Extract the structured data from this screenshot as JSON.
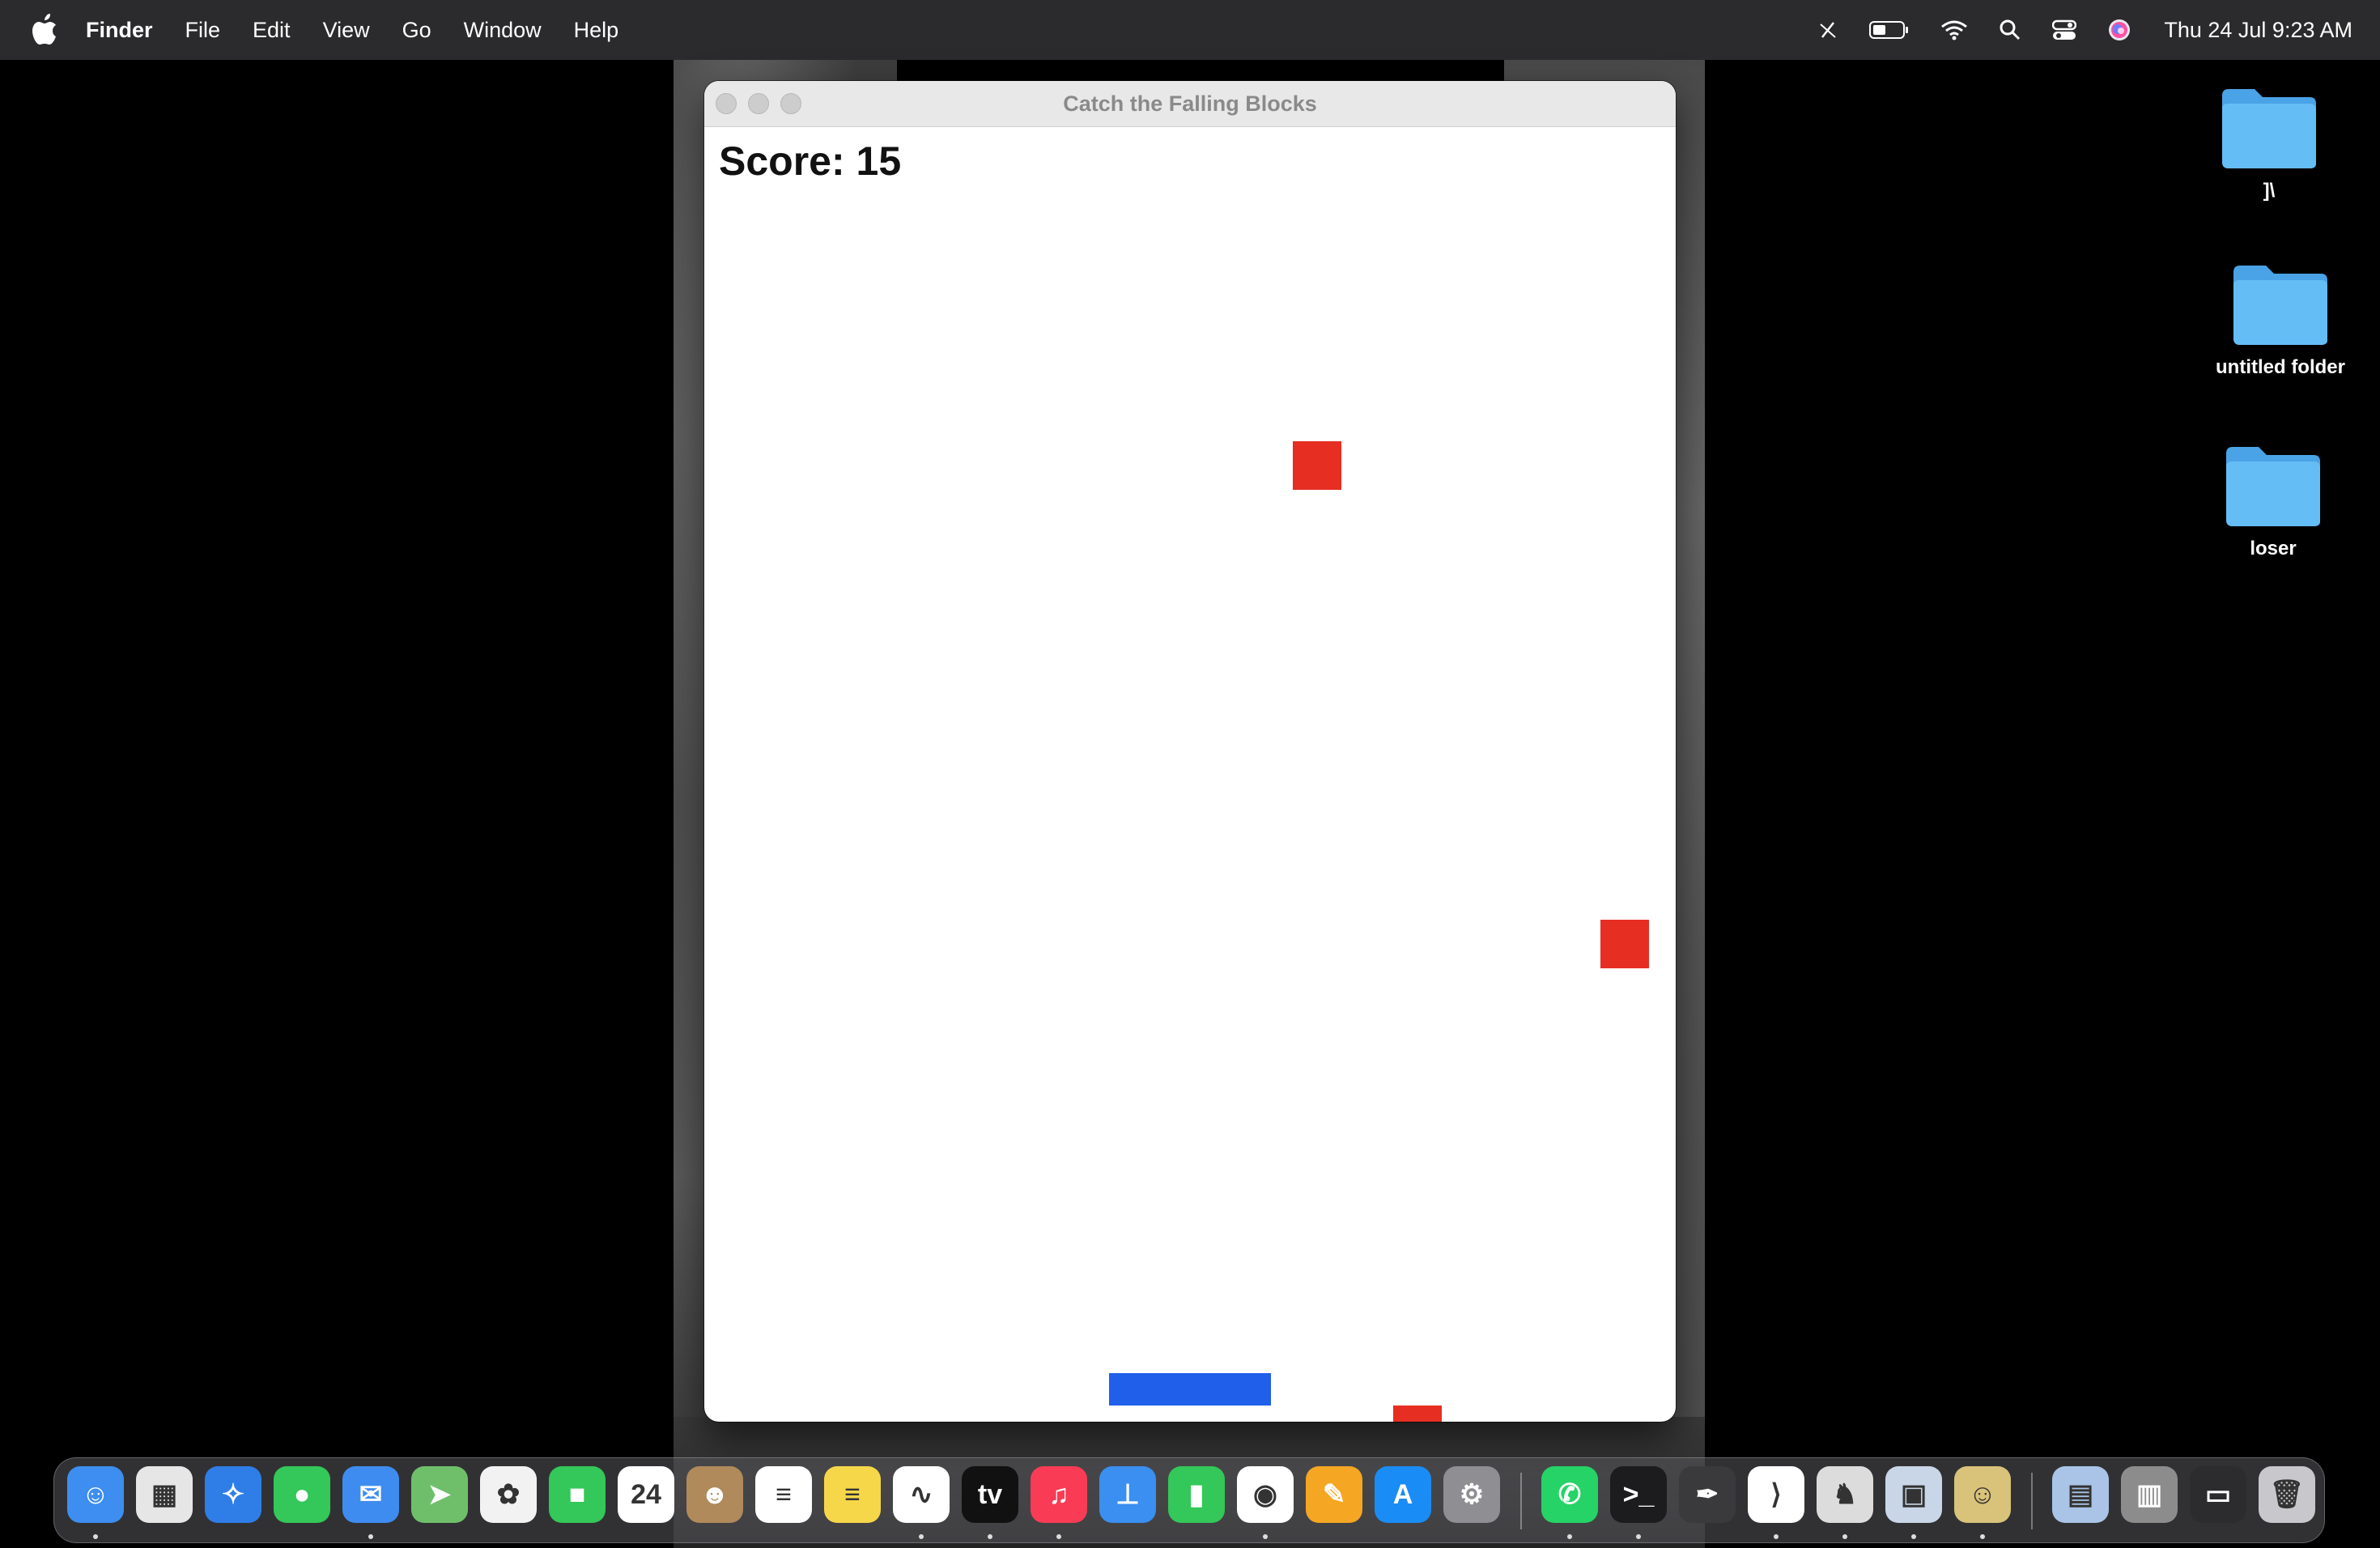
{
  "menubar": {
    "app_name": "Finder",
    "menus": [
      "File",
      "Edit",
      "View",
      "Go",
      "Window",
      "Help"
    ],
    "status_icons": [
      "pen-slash-icon",
      "battery-icon",
      "wifi-icon",
      "search-icon",
      "control-center-icon",
      "siri-icon"
    ],
    "clock": "Thu 24 Jul  9:23 AM"
  },
  "window": {
    "title": "Catch the Falling Blocks",
    "score_text": "Score: 15"
  },
  "game": {
    "score": 15,
    "block_color": "#e62e22",
    "paddle_color": "#1f5fea"
  },
  "desktop": {
    "folders": [
      {
        "label": "]\\"
      },
      {
        "label": "untitled folder"
      },
      {
        "label": "loser"
      }
    ],
    "folder_color": "#5db6f0"
  },
  "dock": {
    "apps": [
      {
        "name": "finder-icon",
        "color": "#3d8ef0",
        "glyph": "☺"
      },
      {
        "name": "launchpad-icon",
        "color": "#e6e6e6",
        "glyph": "▦"
      },
      {
        "name": "safari-icon",
        "color": "#2f7ee8",
        "glyph": "✧"
      },
      {
        "name": "messages-icon",
        "color": "#34c759",
        "glyph": "●"
      },
      {
        "name": "mail-icon",
        "color": "#3f8cf0",
        "glyph": "✉"
      },
      {
        "name": "maps-icon",
        "color": "#6fbf6a",
        "glyph": "➤"
      },
      {
        "name": "photos-icon",
        "color": "#f2f2f2",
        "glyph": "✿"
      },
      {
        "name": "facetime-icon",
        "color": "#34c759",
        "glyph": "■"
      },
      {
        "name": "calendar-icon",
        "color": "#ffffff",
        "glyph": "24"
      },
      {
        "name": "contacts-icon",
        "color": "#b08a5a",
        "glyph": "☻"
      },
      {
        "name": "reminders-icon",
        "color": "#ffffff",
        "glyph": "≡"
      },
      {
        "name": "notes-icon",
        "color": "#f7d74a",
        "glyph": "≡"
      },
      {
        "name": "freeform-icon",
        "color": "#ffffff",
        "glyph": "∿"
      },
      {
        "name": "apple-tv-icon",
        "color": "#111111",
        "glyph": "tv"
      },
      {
        "name": "music-icon",
        "color": "#fa3b55",
        "glyph": "♫"
      },
      {
        "name": "keynote-icon",
        "color": "#3a8ff0",
        "glyph": "⊥"
      },
      {
        "name": "numbers-icon",
        "color": "#34c759",
        "glyph": "▮"
      },
      {
        "name": "chrome-icon",
        "color": "#ffffff",
        "glyph": "◉"
      },
      {
        "name": "pages-icon",
        "color": "#f5a623",
        "glyph": "✎"
      },
      {
        "name": "app-store-icon",
        "color": "#1a8cf5",
        "glyph": "A"
      },
      {
        "name": "system-settings-icon",
        "color": "#8e8e93",
        "glyph": "⚙"
      },
      {
        "name": "whatsapp-icon",
        "color": "#25d366",
        "glyph": "✆"
      },
      {
        "name": "terminal-icon",
        "color": "#1c1c1e",
        "glyph": ">_"
      },
      {
        "name": "pen-tool-icon",
        "color": "#3a3a3c",
        "glyph": "✒"
      },
      {
        "name": "vscode-icon",
        "color": "#ffffff",
        "glyph": "⟩"
      },
      {
        "name": "chess-icon",
        "color": "#dcdcdc",
        "glyph": "♞"
      },
      {
        "name": "preview-icon",
        "color": "#c9d6e8",
        "glyph": "▣"
      },
      {
        "name": "gimp-icon",
        "color": "#d9c27a",
        "glyph": "☺"
      },
      {
        "name": "archive-icon",
        "color": "#a9c4e6",
        "glyph": "▤"
      },
      {
        "name": "documents-stack-icon",
        "color": "#8c8c8c",
        "glyph": "▥"
      },
      {
        "name": "desktop-stack-icon",
        "color": "#2c2c2e",
        "glyph": "▭"
      },
      {
        "name": "trash-icon",
        "color": "#c7c7cc",
        "glyph": "🗑"
      }
    ]
  }
}
